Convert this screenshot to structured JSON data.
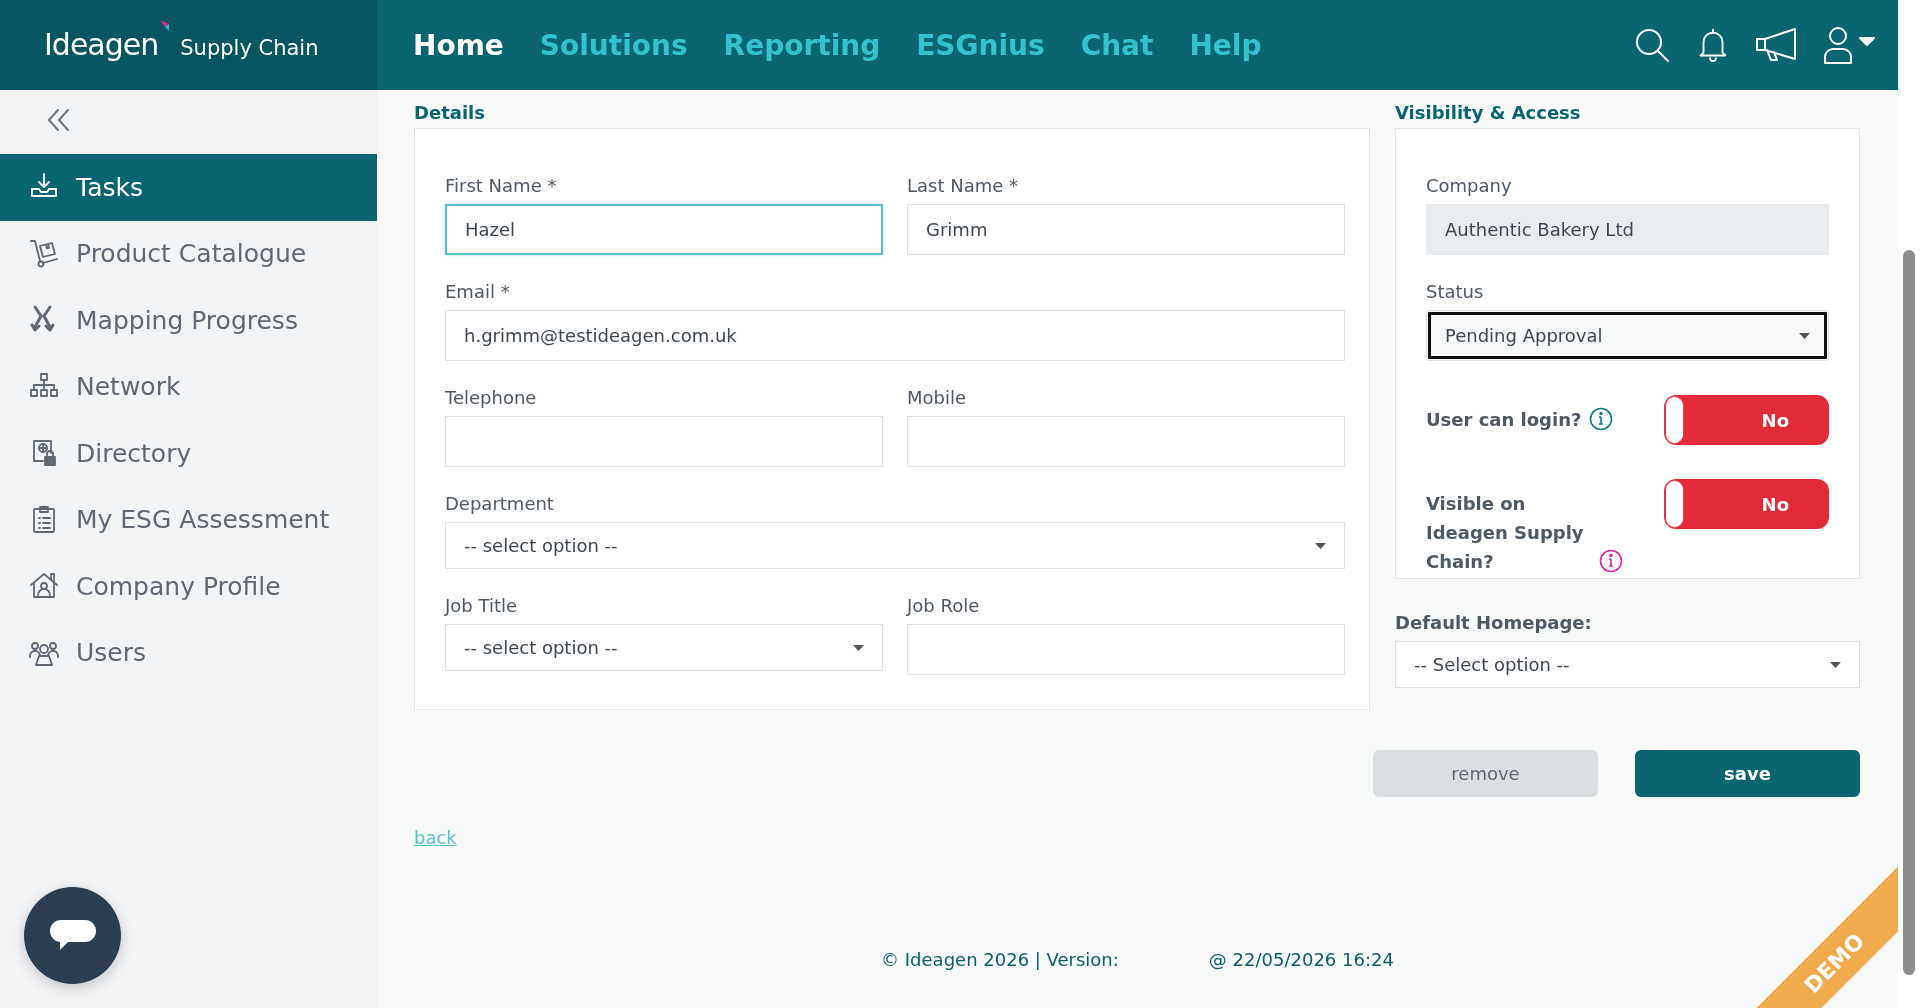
{
  "header": {
    "logo": {
      "brand": "Ideagen",
      "product": "Supply Chain"
    },
    "nav": [
      {
        "label": "Home",
        "selected": true
      },
      {
        "label": "Solutions",
        "selected": false
      },
      {
        "label": "Reporting",
        "selected": false
      },
      {
        "label": "ESGnius",
        "selected": false
      },
      {
        "label": "Chat",
        "selected": false
      },
      {
        "label": "Help",
        "selected": false
      }
    ]
  },
  "sidebar": {
    "items": [
      {
        "label": "Tasks",
        "selected": true
      },
      {
        "label": "Product Catalogue",
        "selected": false
      },
      {
        "label": "Mapping Progress",
        "selected": false
      },
      {
        "label": "Network",
        "selected": false
      },
      {
        "label": "Directory",
        "selected": false
      },
      {
        "label": "My ESG Assessment",
        "selected": false
      },
      {
        "label": "Company Profile",
        "selected": false
      },
      {
        "label": "Users",
        "selected": false
      }
    ]
  },
  "details": {
    "title": "Details",
    "rows": [
      [
        {
          "label": "First Name *",
          "kind": "text",
          "value": "Hazel",
          "focused": true
        },
        {
          "label": "Last Name *",
          "kind": "text",
          "value": "Grimm",
          "focused": false
        }
      ],
      [
        {
          "label": "Email *",
          "kind": "text",
          "value": "h.grimm@testideagen.com.uk",
          "focused": false
        }
      ],
      [
        {
          "label": "Telephone",
          "kind": "text",
          "focused": false
        },
        {
          "label": "Mobile",
          "kind": "text",
          "focused": false
        }
      ],
      [
        {
          "label": "Department",
          "kind": "select",
          "value": "-- select option --",
          "focused": false
        }
      ],
      [
        {
          "label": "Job Title",
          "kind": "select",
          "value": "-- select option --",
          "focused": false
        },
        {
          "label": "Job Role",
          "kind": "text",
          "focused": false
        }
      ]
    ]
  },
  "access": {
    "title": "Visibility & Access",
    "company": {
      "label": "Company",
      "value": "Authentic Bakery Ltd",
      "disabled": true
    },
    "status": {
      "label": "Status",
      "value": "Pending Approval",
      "focused": true
    },
    "toggles": [
      {
        "label": "User can login?",
        "text": "No",
        "on": false,
        "color": "#0f7c86"
      },
      {
        "label": "Visible on Ideagen Supply Chain?",
        "text": "No",
        "on": false,
        "color": "#e0249a"
      }
    ],
    "default_homepage": {
      "label": "Default Homepage:",
      "value": "-- Select option --"
    }
  },
  "actions": [
    {
      "label": "remove",
      "kind": "secondary"
    },
    {
      "label": "save",
      "kind": "primary"
    }
  ],
  "back_link": "back",
  "footer": {
    "copyright": "© Ideagen 2026 | Version:",
    "timestamp": "@ 22/05/2026 16:24"
  },
  "ribbon": "DEMO"
}
